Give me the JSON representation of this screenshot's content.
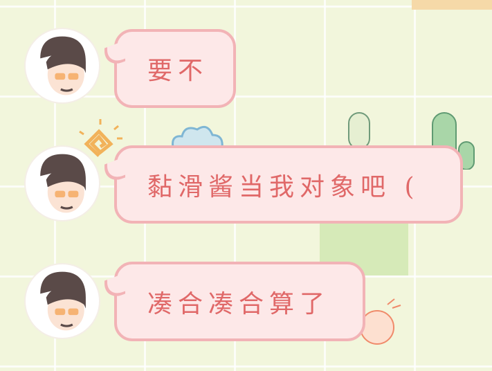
{
  "colors": {
    "bubble_fill": "#fde8e8",
    "bubble_border": "#f2b3b6",
    "text": "#e06868",
    "background": "#f2f6dc"
  },
  "messages": [
    {
      "sender": "avatar",
      "text": "要不"
    },
    {
      "sender": "avatar",
      "text": "黏滑酱当我对象吧 ("
    },
    {
      "sender": "avatar",
      "text": "凑合凑合算了"
    }
  ]
}
